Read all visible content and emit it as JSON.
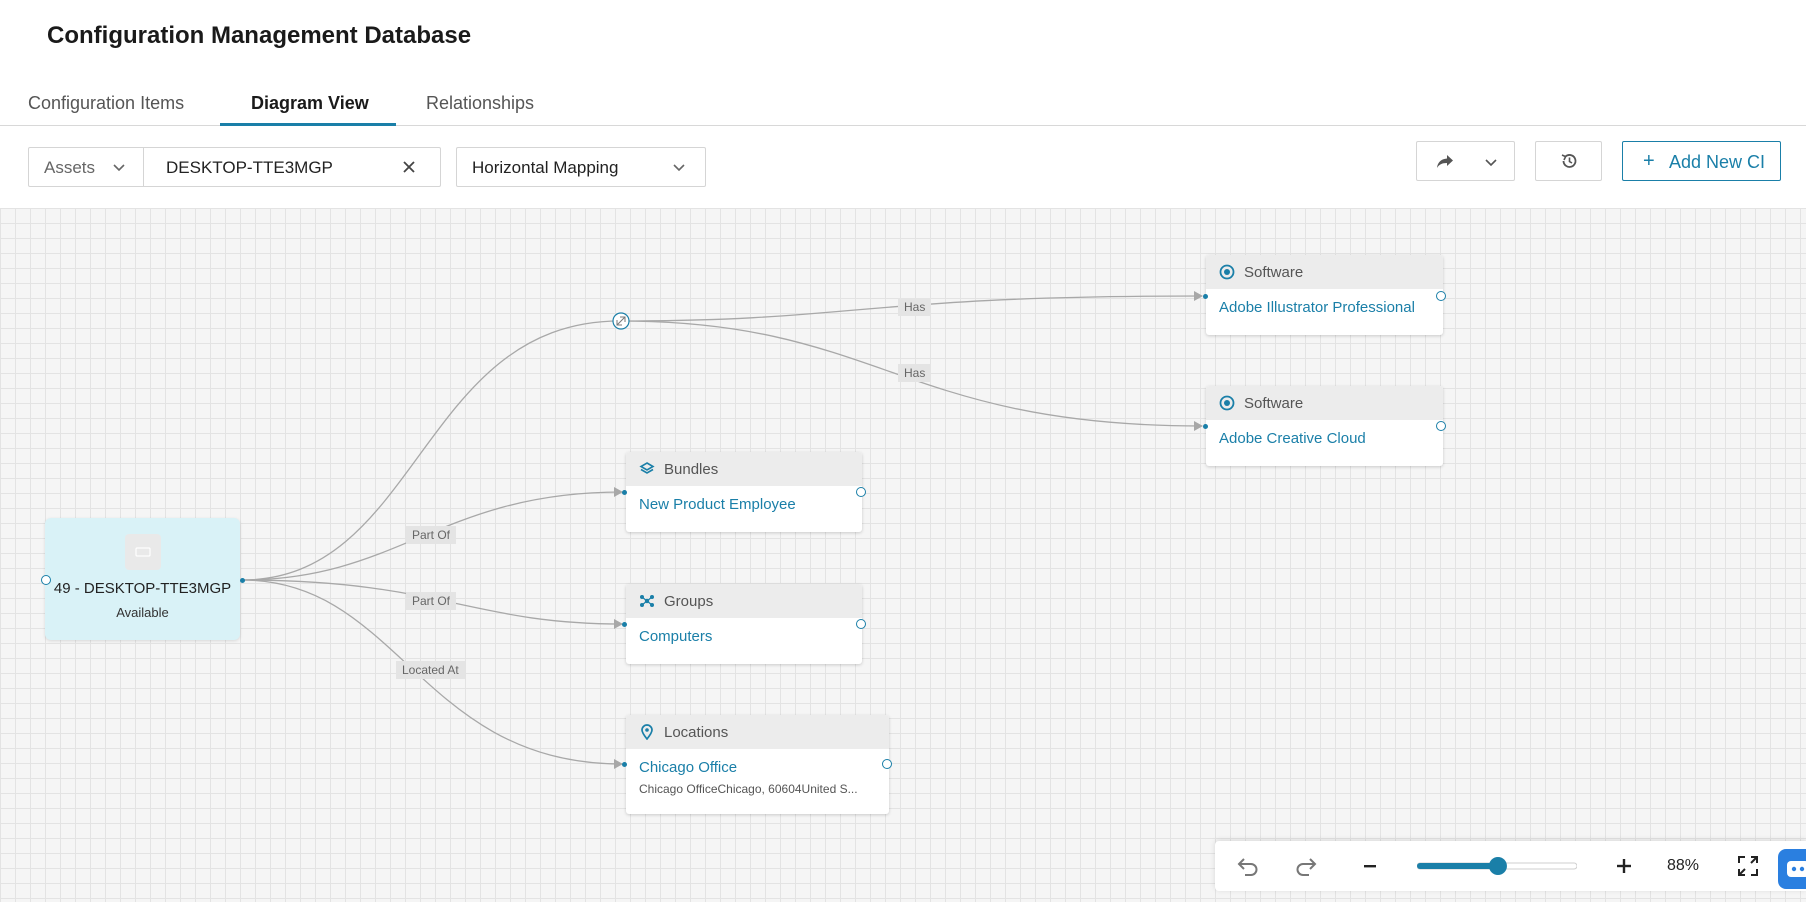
{
  "header": {
    "title": "Configuration Management Database"
  },
  "tabs": [
    {
      "label": "Configuration Items",
      "active": false
    },
    {
      "label": "Diagram View",
      "active": true
    },
    {
      "label": "Relationships",
      "active": false
    }
  ],
  "toolbar": {
    "type_select": "Assets",
    "search_value": "DESKTOP-TTE3MGP",
    "mapping_select": "Horizontal Mapping",
    "add_label": "Add New CI",
    "icons": {
      "share": "share-arrow-icon",
      "history": "history-icon",
      "clear": "close-icon",
      "chevron": "chevron-down-icon"
    }
  },
  "diagram": {
    "root": {
      "title": "49 - DESKTOP-TTE3MGP",
      "status": "Available"
    },
    "nodes": [
      {
        "id": "software-1",
        "type": "Software",
        "icon": "software-icon",
        "name": "Adobe Illustrator Professional"
      },
      {
        "id": "software-2",
        "type": "Software",
        "icon": "software-icon",
        "name": "Adobe Creative Cloud"
      },
      {
        "id": "bundles",
        "type": "Bundles",
        "icon": "layers-icon",
        "name": "New Product Employee"
      },
      {
        "id": "groups",
        "type": "Groups",
        "icon": "groups-icon",
        "name": "Computers"
      },
      {
        "id": "locations",
        "type": "Locations",
        "icon": "location-pin-icon",
        "name": "Chicago Office",
        "detail": "Chicago OfficeChicago, 60604United S..."
      }
    ],
    "edge_labels": [
      "Has",
      "Has",
      "Part Of",
      "Part Of",
      "Located At"
    ]
  },
  "zoom": {
    "level_label": "88%",
    "level": 0.88
  },
  "colors": {
    "accent": "#1a7fa8",
    "root_bg": "#d9f2f7",
    "canvas_bg": "#f5f5f5"
  }
}
